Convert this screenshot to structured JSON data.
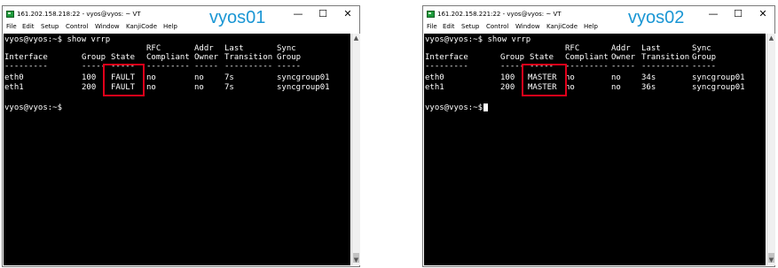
{
  "accent": "#1a96d4",
  "highlight_color": "#e0001a",
  "windows": [
    {
      "title": "161.202.158.218:22 - vyos@vyos: ~ VT",
      "label": "vyos01",
      "menu": [
        "File",
        "Edit",
        "Setup",
        "Control",
        "Window",
        "KanjiCode",
        "Help"
      ],
      "command_line": "vyos@vyos:~$ show vrrp",
      "header_row1": {
        "rfc": "RFC",
        "addr": "Addr",
        "last": "Last",
        "sync": "Sync"
      },
      "header_row2": {
        "interface": "Interface",
        "group": "Group",
        "state": "State",
        "rfc": "Compliant",
        "addr": "Owner",
        "last": "Transition",
        "sync": "Group"
      },
      "separator": {
        "interface": "---------",
        "group": "-----",
        "state": "-----",
        "rfc": "---------",
        "addr": "-----",
        "last": "----------",
        "sync": "-----"
      },
      "rows": [
        {
          "interface": "eth0",
          "group": "100",
          "state": "FAULT",
          "rfc": "no",
          "addr": "no",
          "last": "7s",
          "sync": "syncgroup01"
        },
        {
          "interface": "eth1",
          "group": "200",
          "state": "FAULT",
          "rfc": "no",
          "addr": "no",
          "last": "7s",
          "sync": "syncgroup01"
        }
      ],
      "prompt": "vyos@vyos:~$"
    },
    {
      "title": "161.202.158.221:22 - vyos@vyos: ~ VT",
      "label": "vyos02",
      "menu": [
        "File",
        "Edit",
        "Setup",
        "Control",
        "Window",
        "KanjiCode",
        "Help"
      ],
      "command_line": "vyos@vyos:~$ show vrrp",
      "header_row1": {
        "rfc": "RFC",
        "addr": "Addr",
        "last": "Last",
        "sync": "Sync"
      },
      "header_row2": {
        "interface": "Interface",
        "group": "Group",
        "state": "State",
        "rfc": "Compliant",
        "addr": "Owner",
        "last": "Transition",
        "sync": "Group"
      },
      "separator": {
        "interface": "---------",
        "group": "-----",
        "state": "-----",
        "rfc": "---------",
        "addr": "-----",
        "last": "----------",
        "sync": "-----"
      },
      "rows": [
        {
          "interface": "eth0",
          "group": "100",
          "state": "MASTER",
          "rfc": "no",
          "addr": "no",
          "last": "34s",
          "sync": "syncgroup01"
        },
        {
          "interface": "eth1",
          "group": "200",
          "state": "MASTER",
          "rfc": "no",
          "addr": "no",
          "last": "36s",
          "sync": "syncgroup01"
        }
      ],
      "prompt": "vyos@vyos:~$"
    }
  ]
}
